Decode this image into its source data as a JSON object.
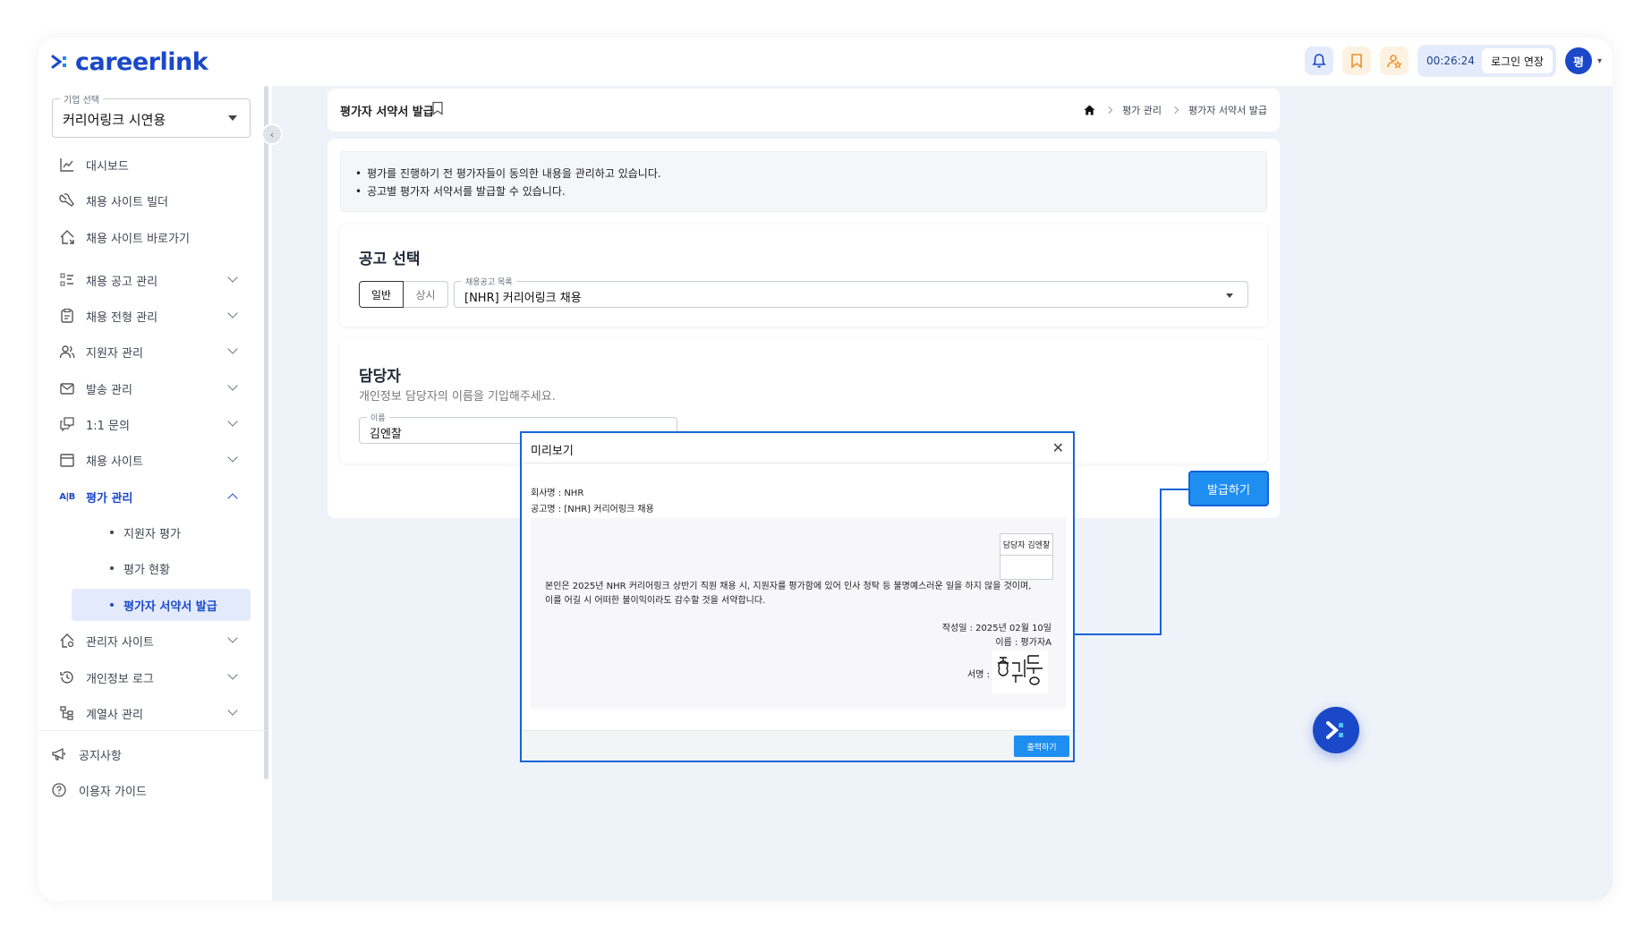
{
  "app": {
    "logo_text": "careerlink"
  },
  "topbar": {
    "timer": "00:26:24",
    "extend_label": "로그인 연장",
    "avatar_initial": "평"
  },
  "sidebar": {
    "company_legend": "기업 선택",
    "company_value": "커리어링크 시연용",
    "items": [
      {
        "label": "대시보드",
        "icon": "chart-icon"
      },
      {
        "label": "채용 사이트 빌더",
        "icon": "wrench-icon"
      },
      {
        "label": "채용 사이트 바로가기",
        "icon": "home-link-icon"
      },
      {
        "label": "채용 공고 관리",
        "icon": "list-icon"
      },
      {
        "label": "채용 전형 관리",
        "icon": "clipboard-icon"
      },
      {
        "label": "지원자 관리",
        "icon": "users-icon"
      },
      {
        "label": "발송 관리",
        "icon": "mail-icon"
      },
      {
        "label": "1:1 문의",
        "icon": "chat-icon"
      },
      {
        "label": "채용 사이트",
        "icon": "window-icon"
      },
      {
        "label": "평가 관리",
        "icon": "ab-icon"
      },
      {
        "label": "관리자 사이트",
        "icon": "home-gear-icon"
      },
      {
        "label": "개인정보 로그",
        "icon": "history-icon"
      },
      {
        "label": "계열사 관리",
        "icon": "tree-icon"
      }
    ],
    "sub_items": [
      "지원자 평가",
      "평가 현황",
      "평가자 서약서 발급"
    ],
    "bottom_items": [
      "공지사항",
      "이용자 가이드"
    ]
  },
  "header": {
    "title": "평가자 서약서 발급",
    "breadcrumb": [
      "평가 관리",
      "평가자 서약서 발급"
    ]
  },
  "info": [
    "평가를 진행하기 전 평가자들이 동의한 내용을 관리하고 있습니다.",
    "공고별 평가자 서약서를 발급할 수 있습니다."
  ],
  "posting": {
    "title": "공고 선택",
    "tab_general": "일반",
    "tab_always": "상시",
    "select_legend": "채용공고 목록",
    "select_value": "[NHR] 커리어링크 채용"
  },
  "manager": {
    "title": "담당자",
    "subtitle": "개인정보 담당자의 이름을 기입해주세요.",
    "field_legend": "이름",
    "field_value": "김엔찰"
  },
  "issue_button": "발급하기",
  "modal": {
    "title": "미리보기",
    "company_line": "회사명 : NHR",
    "posting_line": "공고명 : [NHR] 커리어링크 채용",
    "sign_box_label": "담당자 김엔찰",
    "body_line1": "본인은 2025년 NHR 커리어링크 상반기 직원 채용 시, 지원자를 평가함에 있어 인사 청탁 등 불명예스러운 일을 하지 않을 것이며,",
    "body_line2": "이를 어길 시 어떠한 불이익이라도 감수할 것을 서약합니다.",
    "date_line": "작성일 : 2025년 02월 10일",
    "name_line": "이름 : 평가자A",
    "sign_label": "서명 :",
    "print_label": "출력하기"
  },
  "colors": {
    "brand": "#1a48c8",
    "accent": "#1f8ef1",
    "highlight": "#1565d8"
  }
}
